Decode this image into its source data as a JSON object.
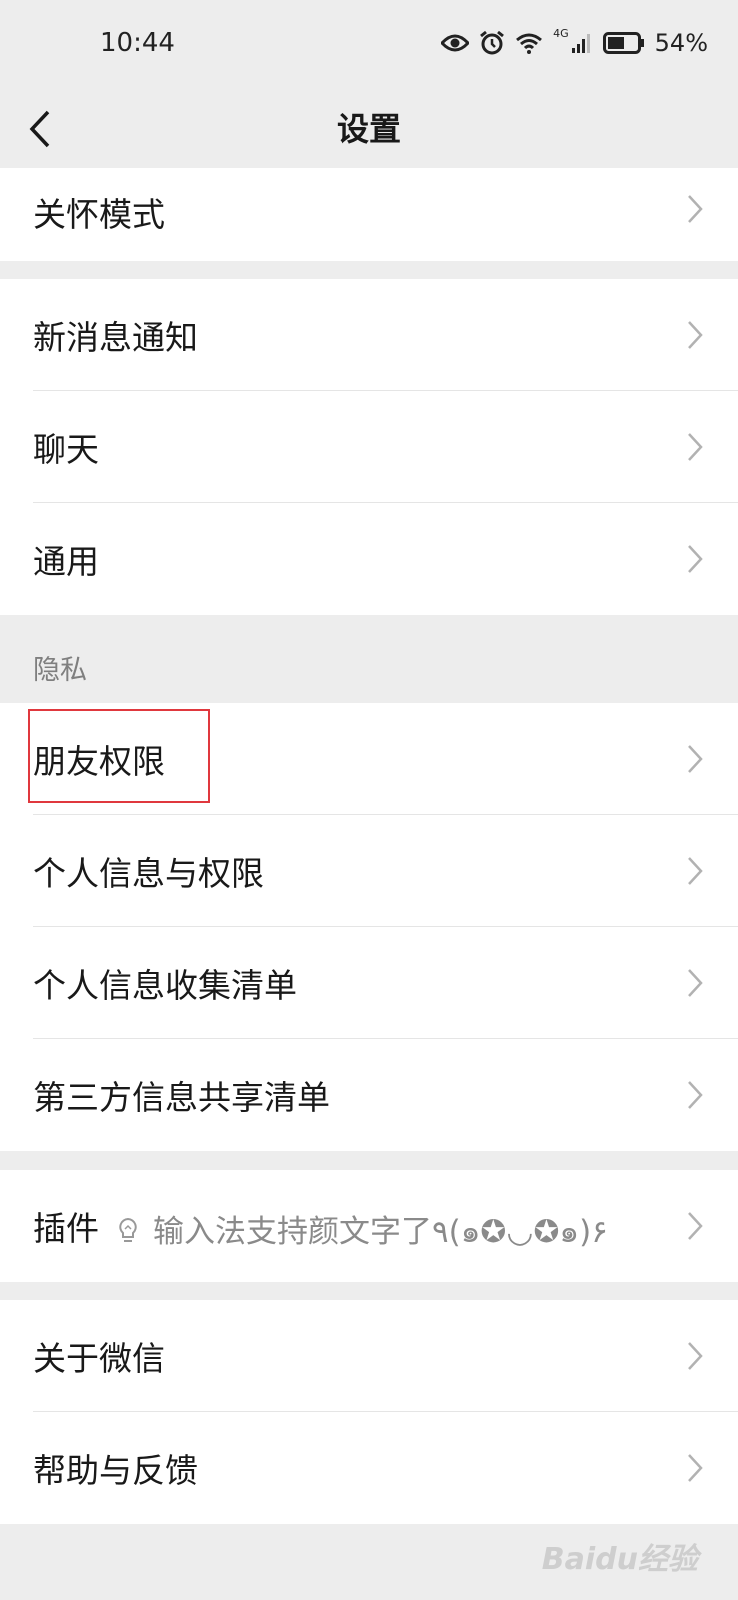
{
  "status_bar": {
    "time": "10:44",
    "network": "4G",
    "battery": "54%"
  },
  "nav": {
    "title": "设置"
  },
  "groups": {
    "care": {
      "items": [
        {
          "label": "关怀模式"
        }
      ]
    },
    "general": {
      "items": [
        {
          "label": "新消息通知"
        },
        {
          "label": "聊天"
        },
        {
          "label": "通用"
        }
      ]
    },
    "privacy": {
      "header": "隐私",
      "items": [
        {
          "label": "朋友权限"
        },
        {
          "label": "个人信息与权限"
        },
        {
          "label": "个人信息收集清单"
        },
        {
          "label": "第三方信息共享清单"
        }
      ]
    },
    "plugins": {
      "items": [
        {
          "label": "插件",
          "tip": "输入法支持颜文字了٩(๑✪◡✪๑)۶"
        }
      ]
    },
    "about": {
      "items": [
        {
          "label": "关于微信"
        },
        {
          "label": "帮助与反馈"
        }
      ]
    }
  },
  "watermark": "Baidu经验",
  "colors": {
    "background": "#ededed",
    "cell": "#ffffff",
    "highlight": "#e0383e",
    "chevron": "#b2b2b2"
  }
}
